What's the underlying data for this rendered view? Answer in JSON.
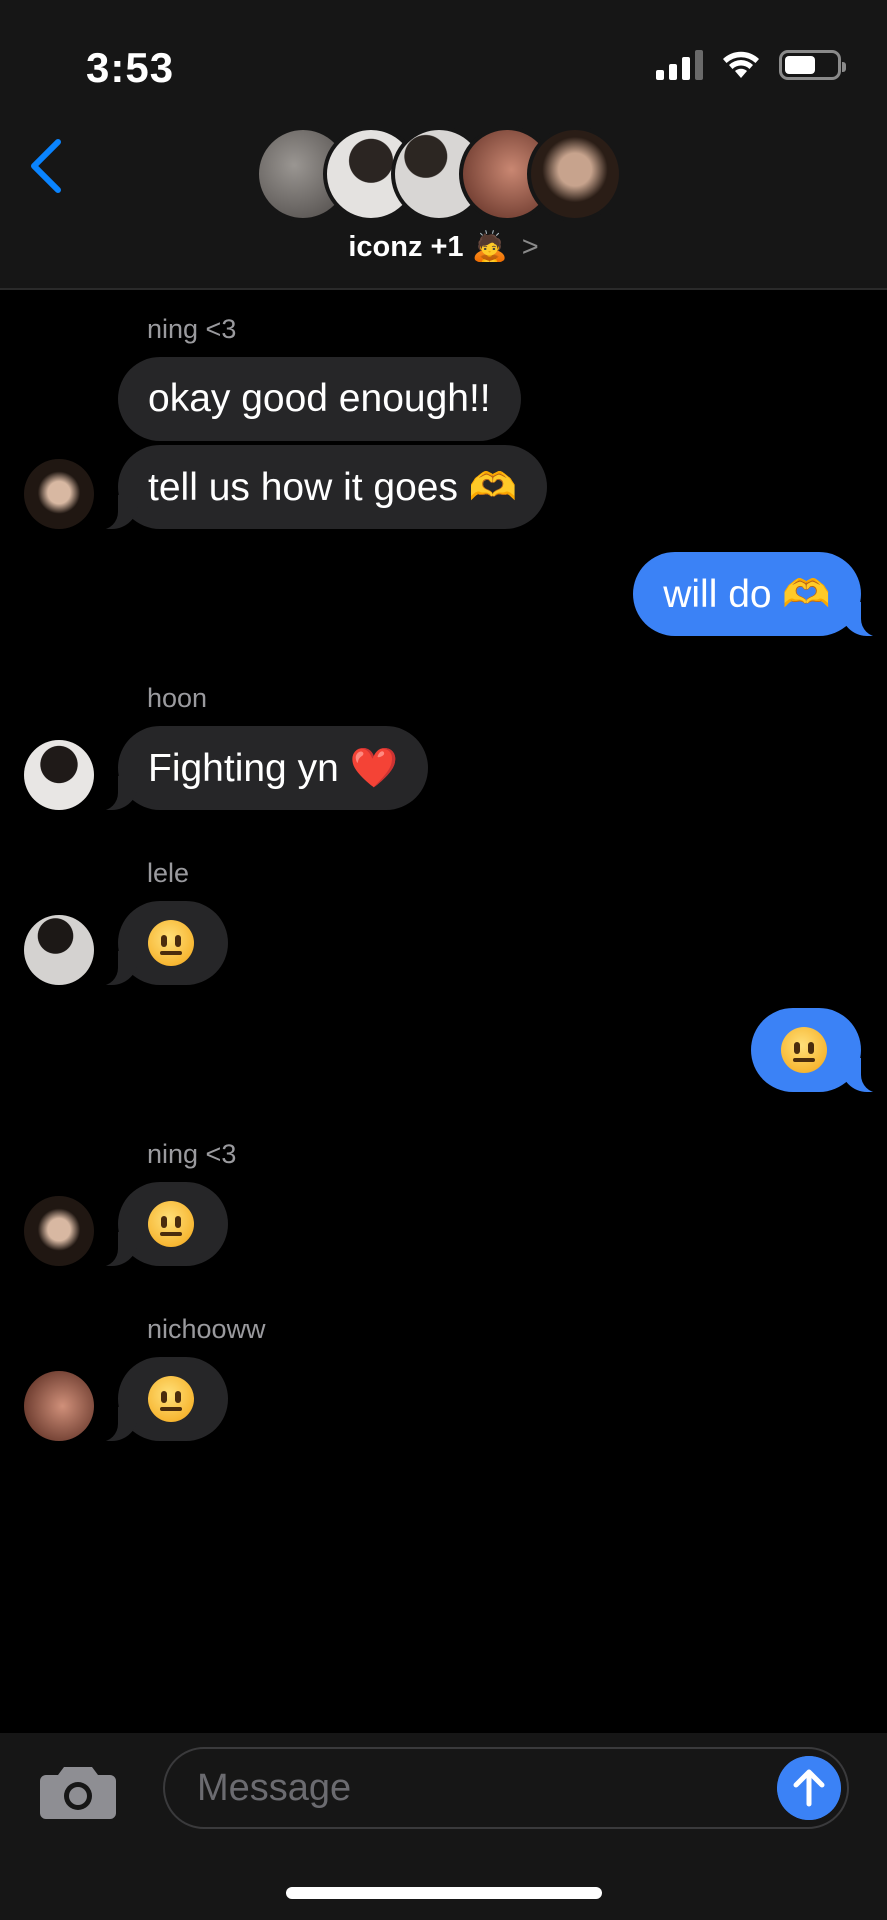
{
  "status_bar": {
    "time": "3:53",
    "signal_bars": 3,
    "battery_level": 0.6
  },
  "header": {
    "title": "iconz +1 🙇",
    "chevron": ">",
    "avatars": [
      "#6e6a66",
      "#dcdad8",
      "#c9c7c5",
      "#8a4a3a",
      "#3a2a22"
    ]
  },
  "messages": [
    {
      "sender": "ning <3"
    },
    {
      "text": "okay good enough!!"
    },
    {
      "text": "tell us how it goes 🫶"
    },
    {
      "text": "will do 🫶"
    },
    {
      "sender": "hoon"
    },
    {
      "text": "Fighting yn ❤️"
    },
    {
      "sender": "lele"
    },
    {
      "sender": "ning <3"
    },
    {
      "sender": "nichooww"
    }
  ],
  "composer": {
    "placeholder": "Message"
  },
  "colors": {
    "incoming_bubble": "#262628",
    "outgoing_bubble": "#3b82f6",
    "accent": "#0a84ff"
  }
}
